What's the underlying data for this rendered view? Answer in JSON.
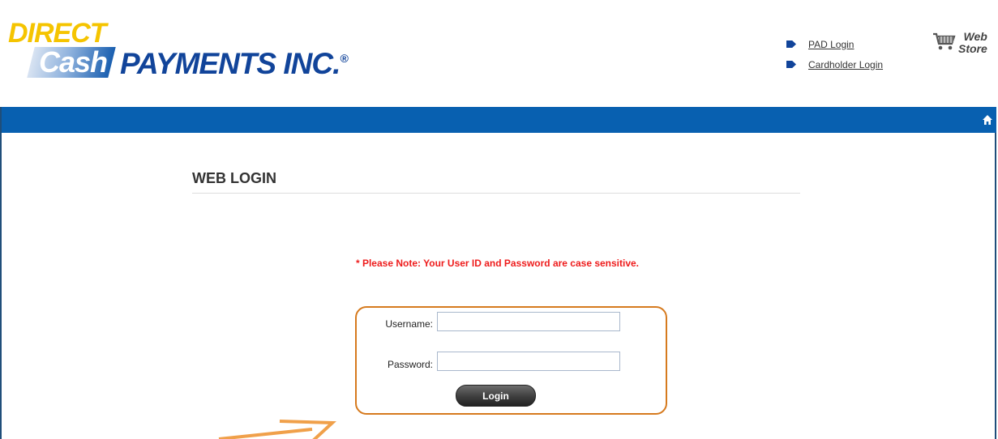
{
  "brand": {
    "logo_line1": "DIRECT",
    "logo_line2": "Cash",
    "logo_line3": "PAYMENTS INC.",
    "logo_mark": "®",
    "colors": {
      "yellow": "#f5c400",
      "navy": "#11449a",
      "nav_blue": "#0860b0"
    }
  },
  "header": {
    "links": [
      {
        "label": "PAD Login"
      },
      {
        "label": "Cardholder Login"
      }
    ],
    "webstore": {
      "line1": "Web",
      "line2": "Store",
      "icon": "shopping-cart-icon"
    }
  },
  "navbar": {
    "icon": "home-icon"
  },
  "page": {
    "title": "WEB LOGIN",
    "note": "* Please Note: Your User ID and Password are case sensitive."
  },
  "form": {
    "username_label": "Username:",
    "username_value": "",
    "password_label": "Password:",
    "password_value": "",
    "login_label": "Login",
    "highlight_color": "#d67a1e"
  }
}
